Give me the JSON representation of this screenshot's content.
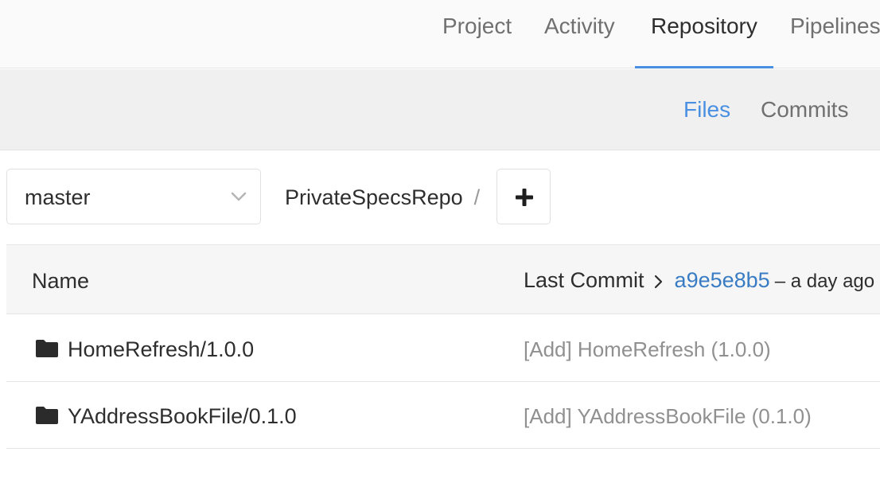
{
  "top_nav": {
    "tabs": [
      {
        "label": "Project"
      },
      {
        "label": "Activity"
      },
      {
        "label": "Repository"
      },
      {
        "label": "Pipelines"
      }
    ],
    "active_tab": "Repository",
    "accent_color": "#4a90e2"
  },
  "sub_nav": {
    "tabs": [
      {
        "label": "Files"
      },
      {
        "label": "Commits"
      }
    ],
    "active_tab": "Files"
  },
  "toolbar": {
    "branch": "master",
    "breadcrumb_repo": "PrivateSpecsRepo",
    "breadcrumb_separator": "/",
    "add_icon": "plus-icon"
  },
  "table": {
    "header": {
      "name": "Name",
      "last_commit": "Last Commit",
      "commit_sha": "a9e5e8b5",
      "commit_time": "– a day ago"
    },
    "rows": [
      {
        "name": "HomeRefresh/1.0.0",
        "commit_message": "[Add] HomeRefresh (1.0.0)",
        "icon": "folder-icon"
      },
      {
        "name": "YAddressBookFile/0.1.0",
        "commit_message": "[Add] YAddressBookFile (0.1.0)",
        "icon": "folder-icon"
      }
    ]
  }
}
